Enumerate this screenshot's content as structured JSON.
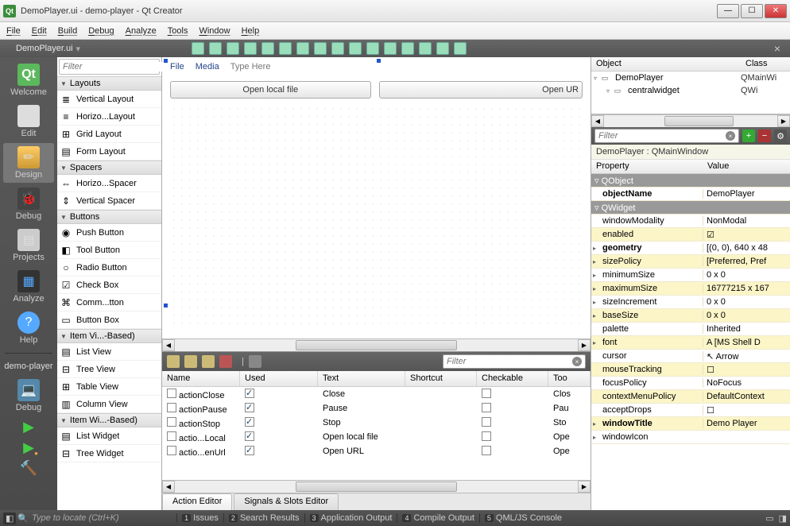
{
  "window": {
    "title": "DemoPlayer.ui - demo-player - Qt Creator"
  },
  "menu": [
    "File",
    "Edit",
    "Build",
    "Debug",
    "Analyze",
    "Tools",
    "Window",
    "Help"
  ],
  "topstrip": {
    "doc": "DemoPlayer.ui"
  },
  "modes": {
    "welcome": "Welcome",
    "edit": "Edit",
    "design": "Design",
    "debug": "Debug",
    "projects": "Projects",
    "analyze": "Analyze",
    "help": "Help",
    "target": "demo-player",
    "target2": "Debug"
  },
  "filter_placeholder": "Filter",
  "widgetbox": {
    "sections": [
      {
        "title": "Layouts",
        "items": [
          {
            "icon": "≣",
            "label": "Vertical Layout"
          },
          {
            "icon": "≡",
            "label": "Horizo...Layout"
          },
          {
            "icon": "⊞",
            "label": "Grid Layout"
          },
          {
            "icon": "▤",
            "label": "Form Layout"
          }
        ]
      },
      {
        "title": "Spacers",
        "items": [
          {
            "icon": "⇔",
            "label": "Horizo...Spacer"
          },
          {
            "icon": "⇕",
            "label": "Vertical Spacer"
          }
        ]
      },
      {
        "title": "Buttons",
        "items": [
          {
            "icon": "◉",
            "label": "Push Button"
          },
          {
            "icon": "◧",
            "label": "Tool Button"
          },
          {
            "icon": "○",
            "label": "Radio Button"
          },
          {
            "icon": "☑",
            "label": "Check Box"
          },
          {
            "icon": "⌘",
            "label": "Comm...tton"
          },
          {
            "icon": "▭",
            "label": "Button Box"
          }
        ]
      },
      {
        "title": "Item Vi...-Based)",
        "items": [
          {
            "icon": "▤",
            "label": "List View"
          },
          {
            "icon": "⊟",
            "label": "Tree View"
          },
          {
            "icon": "⊞",
            "label": "Table View"
          },
          {
            "icon": "▥",
            "label": "Column View"
          }
        ]
      },
      {
        "title": "Item Wi...-Based)",
        "items": [
          {
            "icon": "▤",
            "label": "List Widget"
          },
          {
            "icon": "⊟",
            "label": "Tree Widget"
          }
        ]
      }
    ]
  },
  "canvas": {
    "menus": [
      "File",
      "Media",
      "Type Here"
    ],
    "btn1": "Open local file",
    "btn2": "Open UR"
  },
  "actions": {
    "columns": [
      "Name",
      "Used",
      "Text",
      "Shortcut",
      "Checkable",
      "Too"
    ],
    "rows": [
      {
        "name": "actionClose",
        "used": true,
        "text": "Close",
        "checkable": false,
        "tt": "Clos"
      },
      {
        "name": "actionPause",
        "used": true,
        "text": "Pause",
        "checkable": false,
        "tt": "Pau"
      },
      {
        "name": "actionStop",
        "used": true,
        "text": "Stop",
        "checkable": false,
        "tt": "Sto"
      },
      {
        "name": "actio...Local",
        "used": true,
        "text": "Open local file",
        "checkable": false,
        "tt": "Ope"
      },
      {
        "name": "actio...enUrl",
        "used": true,
        "text": "Open URL",
        "checkable": false,
        "tt": "Ope"
      }
    ],
    "tabs": [
      "Action Editor",
      "Signals & Slots Editor"
    ]
  },
  "inspector": {
    "obj_cols": [
      "Object",
      "Class"
    ],
    "tree": [
      {
        "indent": 0,
        "name": "DemoPlayer",
        "cls": "QMainWi"
      },
      {
        "indent": 1,
        "name": "centralwidget",
        "cls": "QWi"
      }
    ],
    "breadcrumb": "DemoPlayer : QMainWindow",
    "prop_cols": [
      "Property",
      "Value"
    ],
    "props": [
      {
        "type": "group",
        "k": "QObject",
        "v": ""
      },
      {
        "type": "white",
        "k": "objectName",
        "v": "DemoPlayer",
        "bold": true
      },
      {
        "type": "group",
        "k": "QWidget",
        "v": ""
      },
      {
        "type": "white",
        "k": "windowModality",
        "v": "NonModal"
      },
      {
        "type": "yellow",
        "k": "enabled",
        "v": "☑"
      },
      {
        "type": "white",
        "k": "geometry",
        "v": "[(0, 0), 640 x 48",
        "bold": true,
        "exp": true
      },
      {
        "type": "yellow",
        "k": "sizePolicy",
        "v": "[Preferred, Pref",
        "exp": true
      },
      {
        "type": "white",
        "k": "minimumSize",
        "v": "0 x 0",
        "exp": true
      },
      {
        "type": "yellow",
        "k": "maximumSize",
        "v": "16777215 x 167",
        "exp": true
      },
      {
        "type": "white",
        "k": "sizeIncrement",
        "v": "0 x 0",
        "exp": true
      },
      {
        "type": "yellow",
        "k": "baseSize",
        "v": "0 x 0",
        "exp": true
      },
      {
        "type": "white",
        "k": "palette",
        "v": "Inherited"
      },
      {
        "type": "yellow",
        "k": "font",
        "v": "A  [MS Shell D",
        "exp": true
      },
      {
        "type": "white",
        "k": "cursor",
        "v": "↖  Arrow"
      },
      {
        "type": "yellow",
        "k": "mouseTracking",
        "v": "☐"
      },
      {
        "type": "white",
        "k": "focusPolicy",
        "v": "NoFocus"
      },
      {
        "type": "yellow",
        "k": "contextMenuPolicy",
        "v": "DefaultContext"
      },
      {
        "type": "white",
        "k": "acceptDrops",
        "v": "☐"
      },
      {
        "type": "yellow",
        "k": "windowTitle",
        "v": "Demo Player",
        "bold": true,
        "exp": true
      },
      {
        "type": "white",
        "k": "windowIcon",
        "v": "",
        "exp": true
      }
    ]
  },
  "status": {
    "locator": "Type to locate (Ctrl+K)",
    "panels": [
      [
        "1",
        "Issues"
      ],
      [
        "2",
        "Search Results"
      ],
      [
        "3",
        "Application Output"
      ],
      [
        "4",
        "Compile Output"
      ],
      [
        "5",
        "QML/JS Console"
      ]
    ]
  }
}
